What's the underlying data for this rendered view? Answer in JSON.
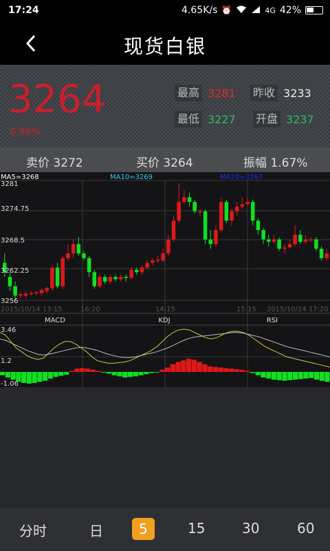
{
  "statusbar": {
    "time": "17:24",
    "speed": "4.65K/s",
    "network": "4G",
    "battery": "42%"
  },
  "nav": {
    "title": "现货白银"
  },
  "quote": {
    "price": "3264",
    "change": "0.96%",
    "high_label": "最高",
    "high": "3281",
    "prev_close_label": "昨收",
    "prev_close": "3233",
    "low_label": "最低",
    "low": "3227",
    "open_label": "开盘",
    "open": "3237"
  },
  "trade": {
    "sell": "卖价 3272",
    "buy": "买价 3264",
    "amplitude": "振幅 1.67%"
  },
  "chart": {
    "ma5": "MA5=3268",
    "ma10": "MA10=3269",
    "ma20": "MA20=3267",
    "y_ticks": [
      "3281",
      "3274.75",
      "3268.5",
      "3262.25",
      "3256"
    ],
    "x_ticks": [
      "2015/10/14 13:15",
      "16:20",
      "14:15",
      "15:15",
      "2015/10/14 17:20"
    ],
    "indicator_tabs": [
      "MACD",
      "KDJ",
      "RSI"
    ],
    "macd_ticks": [
      "3.46",
      "1.2",
      "-1.06"
    ]
  },
  "chart_data": {
    "type": "candlestick",
    "ylim": [
      3256,
      3281
    ],
    "candles": [
      [
        3264,
        3262,
        3266,
        3261
      ],
      [
        3261,
        3259,
        3262,
        3258
      ],
      [
        3259,
        3257,
        3260,
        3256
      ],
      [
        3257,
        3257.3,
        3257.8,
        3256.5
      ],
      [
        3257,
        3257.4,
        3258,
        3256.5
      ],
      [
        3257.3,
        3257.5,
        3258,
        3257
      ],
      [
        3257.5,
        3257.7,
        3258,
        3257
      ],
      [
        3257.5,
        3258.2,
        3258.5,
        3257
      ],
      [
        3258,
        3258.6,
        3259,
        3257.5
      ],
      [
        3258.5,
        3263,
        3263.5,
        3258
      ],
      [
        3263,
        3259,
        3264,
        3258.5
      ],
      [
        3259,
        3265,
        3265.5,
        3258.5
      ],
      [
        3265,
        3266,
        3268,
        3264.5
      ],
      [
        3266,
        3268,
        3269,
        3265
      ],
      [
        3268,
        3266,
        3269.5,
        3265.5
      ],
      [
        3266,
        3265,
        3266.5,
        3264.5
      ],
      [
        3265,
        3262,
        3265.5,
        3261
      ],
      [
        3262,
        3259,
        3262.5,
        3258.5
      ],
      [
        3259,
        3261,
        3261.5,
        3258.5
      ],
      [
        3261,
        3260,
        3261.5,
        3259.5
      ],
      [
        3260,
        3261,
        3261.5,
        3259.5
      ],
      [
        3261,
        3260.5,
        3261.5,
        3260
      ],
      [
        3260.5,
        3261,
        3261.5,
        3260
      ],
      [
        3261,
        3260.8,
        3261.5,
        3260
      ],
      [
        3260.8,
        3262.5,
        3263,
        3260.5
      ],
      [
        3262.5,
        3262,
        3263,
        3261.5
      ],
      [
        3262,
        3263,
        3263.5,
        3261.5
      ],
      [
        3263,
        3264,
        3264.5,
        3262.5
      ],
      [
        3264,
        3264.5,
        3265,
        3263.5
      ],
      [
        3264.5,
        3264.7,
        3265.5,
        3264
      ],
      [
        3264.5,
        3266,
        3267,
        3264
      ],
      [
        3266,
        3269,
        3270,
        3265.5
      ],
      [
        3269,
        3273,
        3274,
        3268.5
      ],
      [
        3273,
        3277,
        3281,
        3272.5
      ],
      [
        3277,
        3278,
        3279.5,
        3276.5
      ],
      [
        3278,
        3277,
        3279,
        3276
      ],
      [
        3277,
        3275,
        3277.5,
        3274.5
      ],
      [
        3275,
        3275,
        3275.5,
        3274
      ],
      [
        3275,
        3269,
        3275.5,
        3268
      ],
      [
        3269,
        3268,
        3271,
        3267
      ],
      [
        3268,
        3271,
        3272,
        3267.5
      ],
      [
        3271,
        3277,
        3278,
        3270.5
      ],
      [
        3277,
        3273,
        3277.5,
        3272.5
      ],
      [
        3273,
        3275,
        3275.5,
        3272
      ],
      [
        3275,
        3276,
        3277,
        3274
      ],
      [
        3276,
        3276.5,
        3278,
        3275.5
      ],
      [
        3276.5,
        3277,
        3278,
        3276
      ],
      [
        3277,
        3273,
        3277.5,
        3272
      ],
      [
        3273,
        3271,
        3273.5,
        3270
      ],
      [
        3271,
        3269,
        3271.5,
        3268
      ],
      [
        3269,
        3268.5,
        3270,
        3267.5
      ],
      [
        3268.5,
        3269,
        3270,
        3268
      ],
      [
        3269,
        3267,
        3269.5,
        3266.5
      ],
      [
        3267,
        3267.3,
        3268,
        3266
      ],
      [
        3267.3,
        3268,
        3269,
        3267
      ],
      [
        3268,
        3270,
        3272,
        3267.5
      ],
      [
        3270,
        3268.5,
        3271,
        3268
      ],
      [
        3268.5,
        3269,
        3270,
        3268
      ],
      [
        3269,
        3269,
        3269.5,
        3268.5
      ],
      [
        3269,
        3267,
        3269.5,
        3266.5
      ],
      [
        3267,
        3265,
        3267.5,
        3264.5
      ],
      [
        3265,
        3266,
        3267,
        3264.5
      ]
    ],
    "macd_ylim": [
      -1.06,
      3.46
    ],
    "macd_hist": [
      -0.3,
      -0.5,
      -0.7,
      -0.9,
      -1.0,
      -1.06,
      -1.0,
      -0.9,
      -0.8,
      -0.6,
      -0.45,
      -0.35,
      -0.25,
      0.1,
      0.3,
      0.35,
      0.3,
      0.2,
      0.1,
      -0.05,
      -0.15,
      -0.3,
      -0.4,
      -0.5,
      -0.45,
      -0.4,
      -0.3,
      -0.2,
      -0.1,
      -0.05,
      0.2,
      0.4,
      0.7,
      0.9,
      1.05,
      1.2,
      1.1,
      0.9,
      0.7,
      0.5,
      0.45,
      0.4,
      0.35,
      0.3,
      0.25,
      0.2,
      0.1,
      -0.1,
      -0.3,
      -0.5,
      -0.6,
      -0.7,
      -0.75,
      -0.8,
      -0.75,
      -0.7,
      -0.65,
      -0.6,
      -0.55,
      -0.7,
      -0.8,
      -0.9
    ],
    "kdj_line": [
      3.2,
      3.0,
      2.5,
      2.0,
      1.7,
      1.4,
      1.2,
      1.1,
      1.2,
      1.6,
      2.0,
      2.3,
      2.5,
      2.5,
      2.3,
      2.0,
      1.7,
      1.3,
      1.0,
      0.9,
      0.8,
      0.8,
      0.85,
      0.9,
      1.0,
      1.2,
      1.4,
      1.6,
      1.8,
      2.1,
      2.5,
      2.9,
      3.2,
      3.4,
      3.46,
      3.4,
      3.2,
      3.0,
      2.8,
      2.7,
      2.8,
      3.0,
      3.2,
      3.3,
      3.3,
      3.2,
      3.0,
      2.7,
      2.4,
      2.1,
      1.9,
      1.7,
      1.5,
      1.3,
      1.2,
      1.1,
      1.0,
      0.9,
      0.8,
      0.7,
      0.6,
      0.5
    ],
    "rsi_line": [
      2.7,
      2.6,
      2.4,
      2.2,
      2.0,
      1.8,
      1.65,
      1.5,
      1.45,
      1.5,
      1.6,
      1.7,
      1.8,
      1.9,
      2.0,
      2.05,
      2.0,
      1.9,
      1.8,
      1.65,
      1.5,
      1.4,
      1.3,
      1.25,
      1.25,
      1.3,
      1.4,
      1.5,
      1.6,
      1.7,
      1.85,
      2.0,
      2.2,
      2.4,
      2.6,
      2.75,
      2.85,
      2.9,
      2.95,
      3.0,
      3.05,
      3.1,
      3.15,
      3.2,
      3.2,
      3.15,
      3.05,
      2.95,
      2.85,
      2.7,
      2.55,
      2.4,
      2.25,
      2.1,
      2.0,
      1.9,
      1.8,
      1.7,
      1.6,
      1.5,
      1.4,
      1.3
    ]
  },
  "colors": {
    "up": "#e01818",
    "down": "#10e020",
    "ma5": "#ffffff",
    "ma10": "#2ecff0",
    "ma20": "#1a2fff",
    "grid": "#3a3a3a"
  },
  "bottom_tabs": [
    "分时",
    "日",
    "5",
    "15",
    "30",
    "60"
  ],
  "bottom_active": "5"
}
